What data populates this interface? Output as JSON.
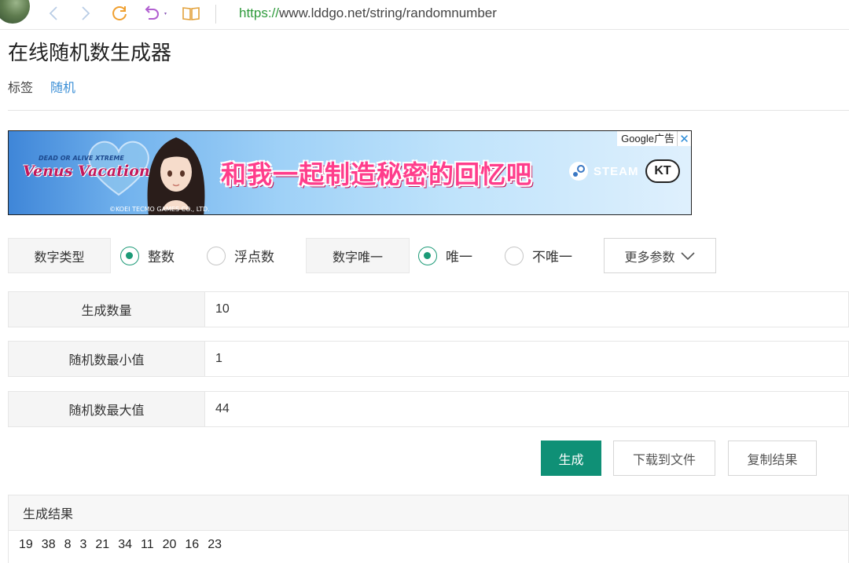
{
  "browser": {
    "url_protocol": "https://",
    "url_rest": "www.lddgo.net/string/randomnumber"
  },
  "page": {
    "title": "在线随机数生成器",
    "tag_label": "标签",
    "tag_link": "随机"
  },
  "ad": {
    "logo_top": "DEAD OR ALIVE XTREME",
    "logo": "Venus Vacation",
    "copyright": "©KOEI TECMO GAMES CO., LTD.",
    "slogan": "和我一起制造秘密的回忆吧",
    "steam": "STEAM",
    "kt": "KT",
    "badge": "Google广告",
    "close": "✕"
  },
  "options": {
    "number_type_label": "数字类型",
    "integer": "整数",
    "float": "浮点数",
    "unique_label": "数字唯一",
    "unique": "唯一",
    "not_unique": "不唯一",
    "more": "更多参数",
    "selected_type": "整数",
    "selected_unique": "唯一"
  },
  "fields": {
    "count_label": "生成数量",
    "count_value": "10",
    "min_label": "随机数最小值",
    "min_value": "1",
    "max_label": "随机数最大值",
    "max_value": "44"
  },
  "buttons": {
    "generate": "生成",
    "download": "下载到文件",
    "copy": "复制结果"
  },
  "results": {
    "title": "生成结果",
    "numbers": [
      "19",
      "38",
      "8",
      "3",
      "21",
      "34",
      "11",
      "20",
      "16",
      "23"
    ]
  },
  "colors": {
    "primary": "#0f9076",
    "radio_checked": "#1c9a77",
    "link": "#3b8fd6",
    "url_protocol": "#2e9a3b"
  }
}
